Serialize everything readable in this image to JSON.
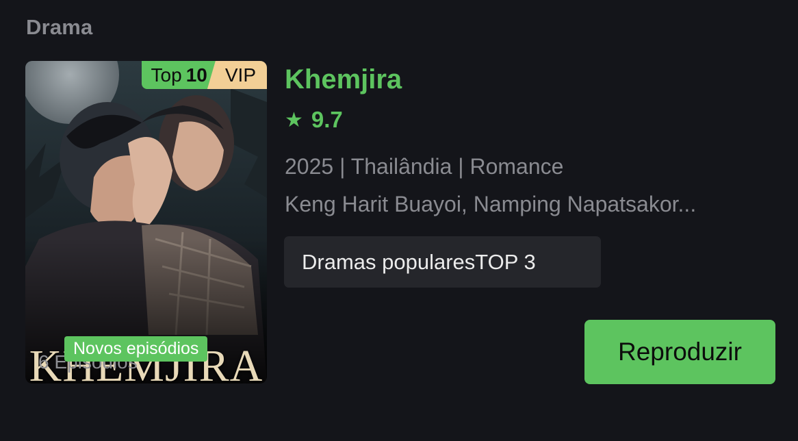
{
  "section": {
    "title": "Drama"
  },
  "poster": {
    "badge_top_prefix": "Top",
    "badge_top_number": "10",
    "badge_vip": "VIP",
    "poster_title": "KHEMJIRA",
    "episodes_label": "6 Episódios",
    "new_badge": "Novos episódios"
  },
  "info": {
    "title": "Khemjira",
    "star_icon": "★",
    "rating": "9.7",
    "meta": "2025 | Thailândia | Romance",
    "cast": "Keng Harit Buayoi, Namping Napatsakor...",
    "tag": "Dramas popularesTOP 3",
    "play_label": "Reproduzir"
  },
  "colors": {
    "accent": "#5dc45f",
    "vip": "#f2cf96",
    "background": "#14151a",
    "muted_text": "#8a8b91",
    "tag_bg": "#25262b"
  }
}
